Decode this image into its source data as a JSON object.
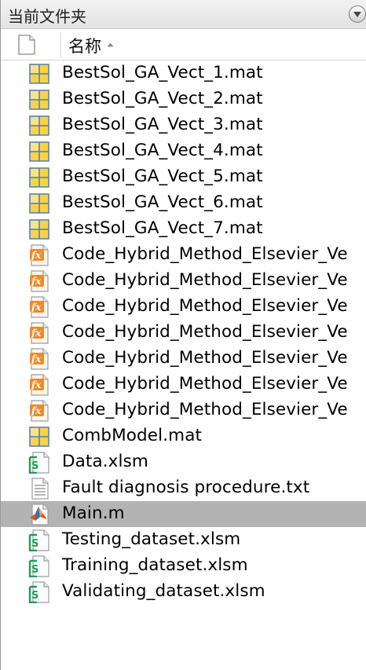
{
  "panel": {
    "title": "当前文件夹",
    "menu_icon": "triangle-down-icon"
  },
  "header": {
    "name_label": "名称",
    "type_icon": "blank-file-icon",
    "sort_icon": "sort-ascending-icon"
  },
  "files": [
    {
      "name": "BestSol_GA_Vect_1.mat",
      "type": "mat"
    },
    {
      "name": "BestSol_GA_Vect_2.mat",
      "type": "mat"
    },
    {
      "name": "BestSol_GA_Vect_3.mat",
      "type": "mat"
    },
    {
      "name": "BestSol_GA_Vect_4.mat",
      "type": "mat"
    },
    {
      "name": "BestSol_GA_Vect_5.mat",
      "type": "mat"
    },
    {
      "name": "BestSol_GA_Vect_6.mat",
      "type": "mat"
    },
    {
      "name": "BestSol_GA_Vect_7.mat",
      "type": "mat"
    },
    {
      "name": "Code_Hybrid_Method_Elsevier_Ve",
      "type": "func"
    },
    {
      "name": "Code_Hybrid_Method_Elsevier_Ve",
      "type": "func"
    },
    {
      "name": "Code_Hybrid_Method_Elsevier_Ve",
      "type": "func"
    },
    {
      "name": "Code_Hybrid_Method_Elsevier_Ve",
      "type": "func"
    },
    {
      "name": "Code_Hybrid_Method_Elsevier_Ve",
      "type": "func"
    },
    {
      "name": "Code_Hybrid_Method_Elsevier_Ve",
      "type": "func"
    },
    {
      "name": "Code_Hybrid_Method_Elsevier_Ve",
      "type": "func"
    },
    {
      "name": "CombModel.mat",
      "type": "mat"
    },
    {
      "name": "Data.xlsm",
      "type": "xlsm"
    },
    {
      "name": "Fault diagnosis procedure.txt",
      "type": "txt"
    },
    {
      "name": "Main.m",
      "type": "script",
      "selected": true
    },
    {
      "name": "Testing_dataset.xlsm",
      "type": "xlsm"
    },
    {
      "name": "Training_dataset.xlsm",
      "type": "xlsm"
    },
    {
      "name": "Validating_dataset.xlsm",
      "type": "xlsm"
    }
  ],
  "colors": {
    "selected_row": "#b3b3b3",
    "mat_icon_fill": "#f7d34a",
    "func_icon_fill": "#f08a2a",
    "xlsm_icon_green": "#1f9d55"
  }
}
